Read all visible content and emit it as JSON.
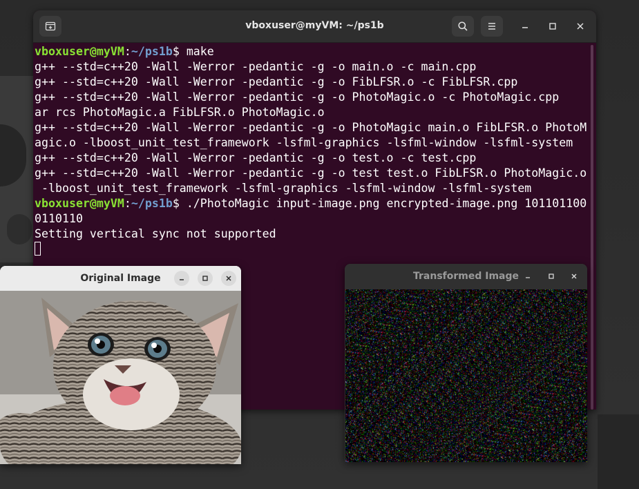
{
  "terminal": {
    "title": "vboxuser@myVM: ~/ps1b",
    "prompt_user": "vboxuser@myVM",
    "prompt_sep": ":",
    "prompt_path": "~/ps1b",
    "prompt_end": "$ ",
    "lines": [
      {
        "kind": "prompt",
        "cmd": "make"
      },
      {
        "kind": "out",
        "text": "g++ --std=c++20 -Wall -Werror -pedantic -g -o main.o -c main.cpp"
      },
      {
        "kind": "out",
        "text": "g++ --std=c++20 -Wall -Werror -pedantic -g -o FibLFSR.o -c FibLFSR.cpp"
      },
      {
        "kind": "out",
        "text": "g++ --std=c++20 -Wall -Werror -pedantic -g -o PhotoMagic.o -c PhotoMagic.cpp"
      },
      {
        "kind": "out",
        "text": "ar rcs PhotoMagic.a FibLFSR.o PhotoMagic.o"
      },
      {
        "kind": "out",
        "text": "g++ --std=c++20 -Wall -Werror -pedantic -g -o PhotoMagic main.o FibLFSR.o PhotoM"
      },
      {
        "kind": "out",
        "text": "agic.o -lboost_unit_test_framework -lsfml-graphics -lsfml-window -lsfml-system"
      },
      {
        "kind": "out",
        "text": "g++ --std=c++20 -Wall -Werror -pedantic -g -o test.o -c test.cpp"
      },
      {
        "kind": "out",
        "text": "g++ --std=c++20 -Wall -Werror -pedantic -g -o test test.o FibLFSR.o PhotoMagic.o"
      },
      {
        "kind": "out",
        "text": " -lboost_unit_test_framework -lsfml-graphics -lsfml-window -lsfml-system"
      },
      {
        "kind": "prompt",
        "cmd": "./PhotoMagic input-image.png encrypted-image.png 101101100"
      },
      {
        "kind": "out",
        "text": "0110110"
      },
      {
        "kind": "out",
        "text": "Setting vertical sync not supported"
      }
    ],
    "buttons": {
      "new_tab": "new-tab-icon",
      "search": "search-icon",
      "menu": "hamburger-menu-icon",
      "minimize": "minimize-icon",
      "maximize": "maximize-icon",
      "close": "close-icon"
    },
    "colors": {
      "background": "#300a24",
      "prompt_user": "#8ae234",
      "prompt_path": "#729fcf"
    }
  },
  "original_window": {
    "title": "Original Image",
    "image_subject": "kitten"
  },
  "transformed_window": {
    "title": "Transformed Image",
    "image_subject": "random color noise"
  }
}
